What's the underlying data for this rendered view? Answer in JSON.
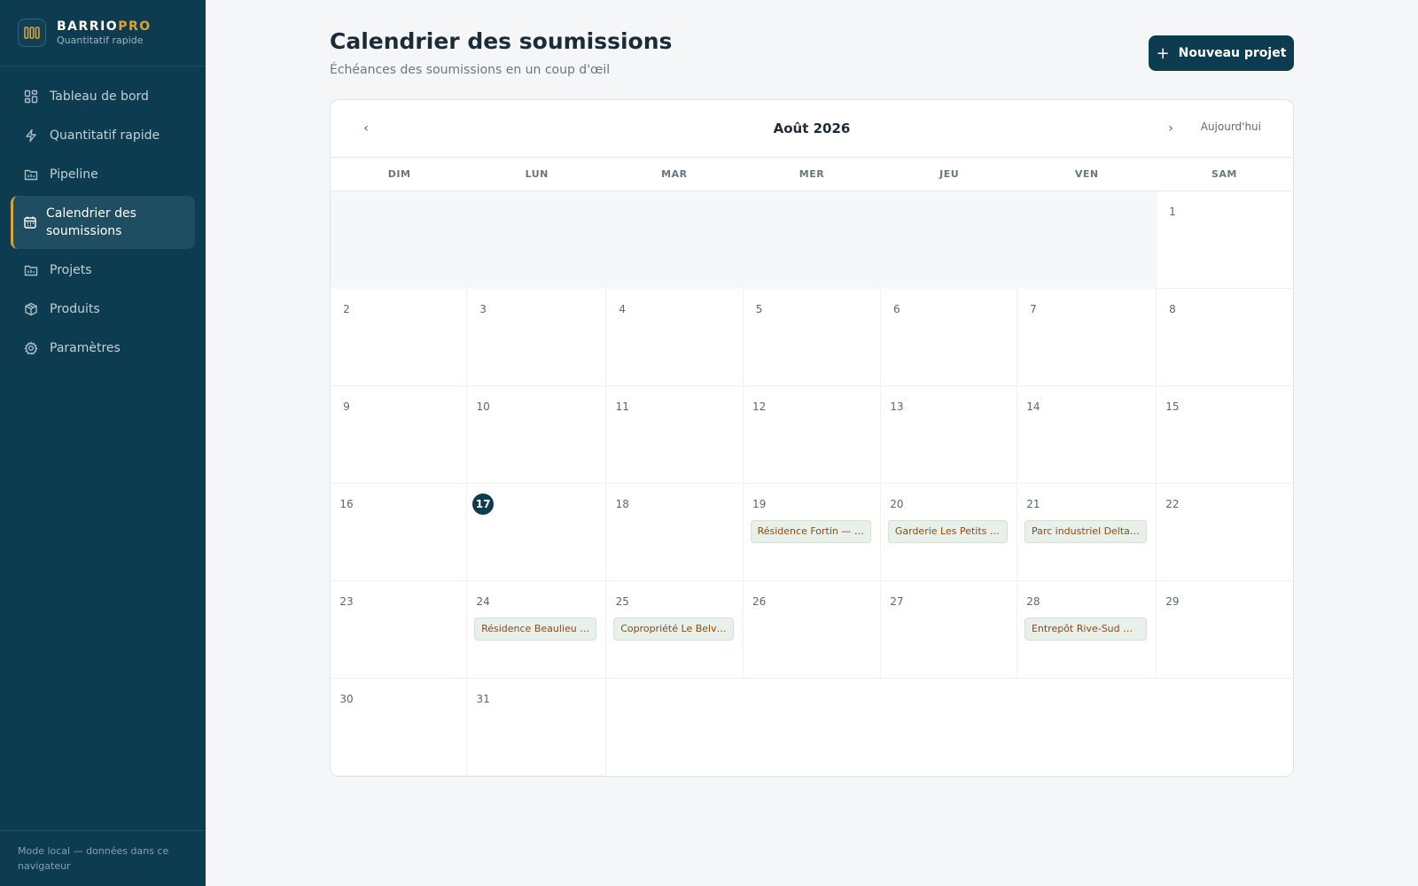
{
  "brand": {
    "name_main": "BARRIO",
    "name_accent": "PRO",
    "subtitle": "Quantitatif rapide"
  },
  "sidebar": {
    "items": [
      {
        "label": "Tableau de bord",
        "icon": "dashboard-icon",
        "active": false
      },
      {
        "label": "Quantitatif rapide",
        "icon": "lightning-icon",
        "active": false
      },
      {
        "label": "Pipeline",
        "icon": "folder-chart-icon",
        "active": false
      },
      {
        "label": "Calendrier des soumissions",
        "icon": "calendar-icon",
        "active": true
      },
      {
        "label": "Projets",
        "icon": "folder-chart-icon",
        "active": false
      },
      {
        "label": "Produits",
        "icon": "box-icon",
        "active": false
      },
      {
        "label": "Paramètres",
        "icon": "gear-icon",
        "active": false
      }
    ],
    "footer": "Mode local — données dans ce navigateur"
  },
  "header": {
    "title": "Calendrier des soumissions",
    "subtitle": "Échéances des soumissions en un coup d'œil",
    "new_button": "Nouveau projet"
  },
  "calendar": {
    "month_label": "Août 2026",
    "prev": "‹",
    "next": "›",
    "today_label": "Aujourd'hui",
    "weekdays": [
      "DIM",
      "LUN",
      "MAR",
      "MER",
      "JEU",
      "VEN",
      "SAM"
    ],
    "leading_empty": 6,
    "days_in_month": 31,
    "today": 17,
    "events": [
      {
        "day": 19,
        "label": "Résidence Fortin — …"
      },
      {
        "day": 20,
        "label": "Garderie Les Petits …"
      },
      {
        "day": 21,
        "label": "Parc industriel Delta…"
      },
      {
        "day": 24,
        "label": "Résidence Beaulieu …"
      },
      {
        "day": 25,
        "label": "Copropriété Le Belv…"
      },
      {
        "day": 28,
        "label": "Entrepôt Rive-Sud …"
      }
    ]
  },
  "colors": {
    "sidebar": "#0d3b4f",
    "accent": "#d8a43a",
    "event_text": "#8a4b12",
    "event_bg": "#e9efe9"
  }
}
